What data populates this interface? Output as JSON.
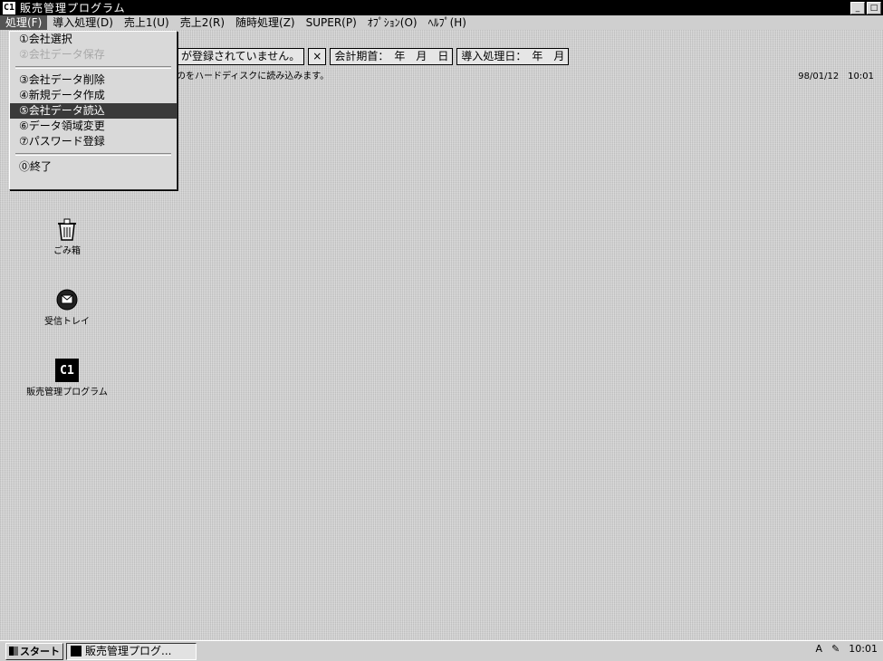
{
  "window": {
    "app_icon": "C1",
    "title": "販売管理プログラム",
    "min_btn": "_",
    "max_btn": "□"
  },
  "menubar": {
    "items": [
      "処理(F)",
      "導入処理(D)",
      "売上1(U)",
      "売上2(R)",
      "随時処理(Z)",
      "SUPER(P)",
      "ｵﾌﾟｼｮﾝ(O)",
      "ﾍﾙﾌﾟ(H)"
    ]
  },
  "dropdown": {
    "items": [
      {
        "label": "①会社選択",
        "state": "normal"
      },
      {
        "label": "②会社データ保存",
        "state": "disabled"
      },
      {
        "label": "③会社データ削除",
        "state": "normal"
      },
      {
        "label": "④新規データ作成",
        "state": "normal"
      },
      {
        "label": "⑤会社データ読込",
        "state": "selected"
      },
      {
        "label": "⑥データ領域変更",
        "state": "normal"
      },
      {
        "label": "⑦パスワード登録",
        "state": "normal"
      },
      {
        "label": "⓪終了",
        "state": "normal"
      }
    ]
  },
  "toolbar": {
    "company_field": "が登録されていません。",
    "close_mark": "×",
    "period_field": "会計期首：　年　月　日",
    "import_field": "導入処理日：　年　月"
  },
  "status": {
    "message": "のをハードディスクに読み込みます。",
    "datetime": "98/01/12　10:01"
  },
  "desktop": {
    "icons": [
      {
        "label": "ごみ箱",
        "glyph": "♻"
      },
      {
        "label": "受信トレイ",
        "glyph": "✉"
      },
      {
        "label": "販売管理プログラム",
        "glyph": "C1"
      }
    ]
  },
  "taskbar": {
    "start_label": "スタート",
    "task_label": "販売管理プログ...",
    "ime": "A",
    "clock": "10:01"
  }
}
